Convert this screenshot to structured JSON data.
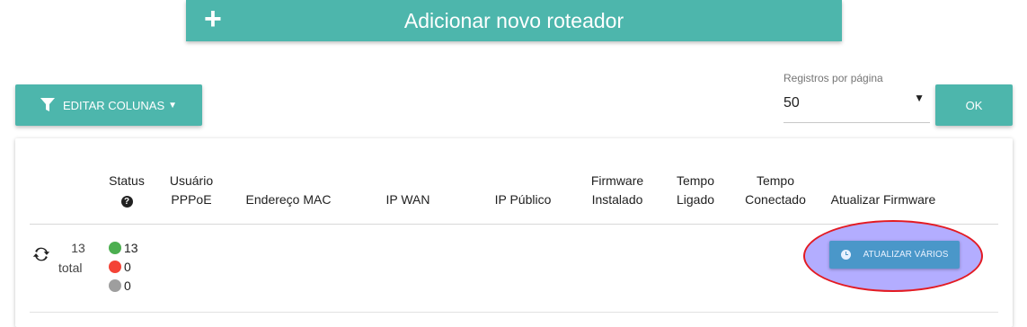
{
  "add_router": {
    "label": "Adicionar novo roteador"
  },
  "toolbar": {
    "edit_columns_label": "EDITAR COLUNAS"
  },
  "pagination": {
    "label": "Registros por página",
    "selected": "50",
    "ok_label": "OK"
  },
  "table": {
    "headers": {
      "status": "Status",
      "usuario_l1": "Usuário",
      "usuario_l2": "PPPoE",
      "mac": "Endereço MAC",
      "ip_wan": "IP WAN",
      "ip_publico": "IP Público",
      "firmware_l1": "Firmware",
      "firmware_l2": "Instalado",
      "ligado_l1": "Tempo",
      "ligado_l2": "Ligado",
      "conectado_l1": "Tempo",
      "conectado_l2": "Conectado",
      "atualizar": "Atualizar Firmware"
    },
    "summary": {
      "total_count": "13",
      "total_label": "total",
      "online": "13",
      "offline": "0",
      "unknown": "0"
    },
    "update_many_label": "ATUALIZAR VÁRIOS"
  },
  "colors": {
    "primary": "#4db6ac",
    "online": "#4caf50",
    "offline": "#f44336",
    "unknown": "#9e9e9e",
    "update": "#4a97c9",
    "highlight": "#e31b23"
  }
}
